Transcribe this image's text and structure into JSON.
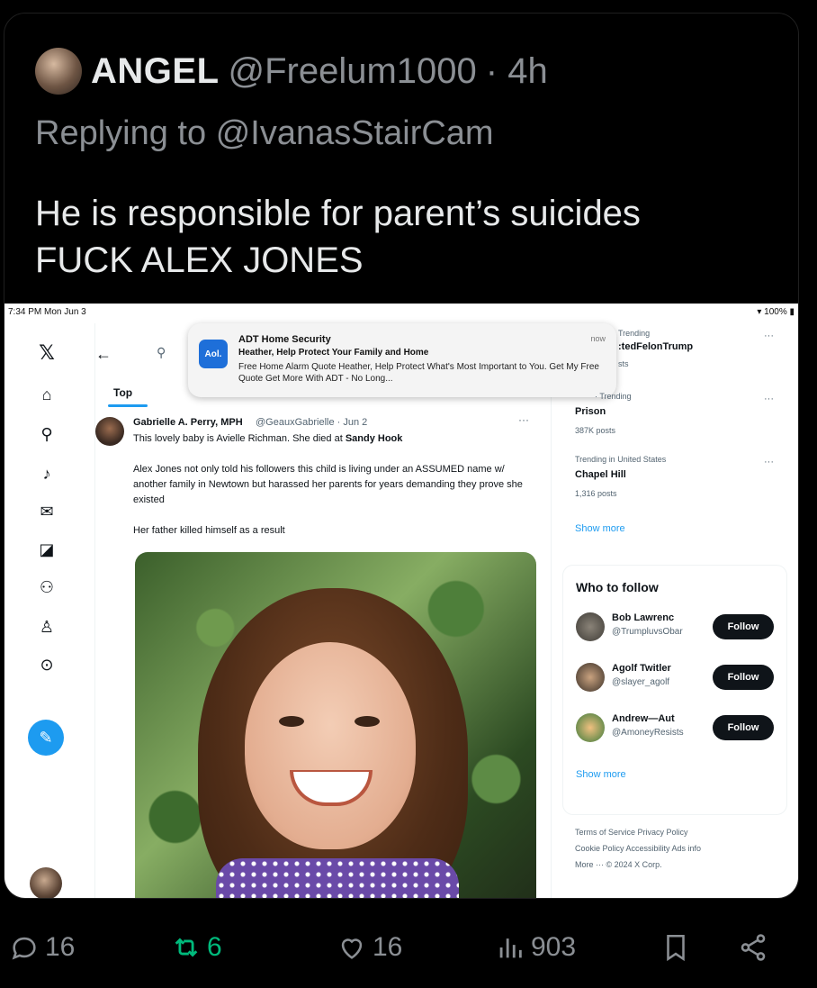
{
  "tweet": {
    "author_name": "ANGEL",
    "author_handle": "@Freelum1000",
    "time": "· 4h",
    "replying_to_prefix": "Replying to",
    "replying_to": "@IvanasStairCam",
    "text_line1": "He is responsible for parent’s suicides",
    "text_line2": "FUCK ALEX JONES"
  },
  "screenshot": {
    "status_time": "7:34 PM  Mon Jun 3",
    "battery": "100%",
    "notification": {
      "app_icon": "Aol.",
      "title": "ADT Home Security",
      "subtitle": "Heather, Help Protect Your Family and Home",
      "body": "Free Home Alarm Quote Heather, Help Protect What's Most Important to You. Get My Free Quote Get More With ADT - No Long...",
      "time": "now"
    },
    "main": {
      "tab": "Top",
      "post_name": "Gabrielle A. Perry, MPH",
      "post_handle": "@GeauxGabrielle · Jun 2",
      "post_line1_a": "This lovely baby is Avielle Richman. She died at ",
      "post_line1_b": "Sandy Hook",
      "post_para2": "Alex Jones not only told his followers this child is living under an ASSUMED name w/ another family in Newtown but harassed her parents for years demanding they prove she existed",
      "post_para3": "Her father killed himself as a result"
    },
    "trends": [
      {
        "label": "Trending",
        "name": ":tedFelonTrump",
        "posts": "sts"
      },
      {
        "label": "· Trending",
        "name": "Prison",
        "posts": "387K posts"
      },
      {
        "label": "Trending in United States",
        "name": "Chapel Hill",
        "posts": "1,316 posts"
      }
    ],
    "show_more": "Show more",
    "who_to_follow": {
      "title": "Who to follow",
      "follow_label": "Follow",
      "people": [
        {
          "name": "Bob Lawrenc",
          "handle": "@TrumpluvsObar"
        },
        {
          "name": "Agolf Twitler",
          "handle": "@slayer_agolf"
        },
        {
          "name": "Andrew—Aut",
          "handle": "@AmoneyResists"
        }
      ],
      "show_more": "Show more"
    },
    "footer": {
      "line1": "Terms of Service   Privacy Policy",
      "line2": "Cookie Policy   Accessibility   Ads info",
      "line3": "More ···   © 2024 X Corp."
    }
  },
  "actions": {
    "replies": "16",
    "reposts": "6",
    "likes": "16",
    "views": "903"
  }
}
